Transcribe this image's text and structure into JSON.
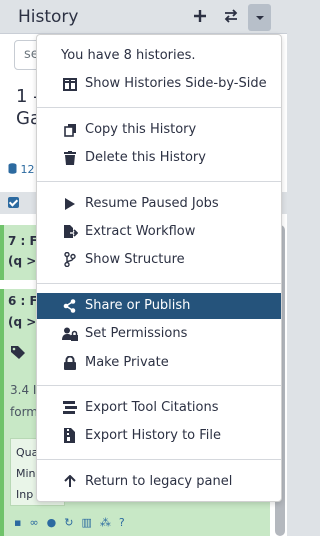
{
  "header": {
    "title": "History"
  },
  "search": {
    "partial_text": "se"
  },
  "history": {
    "name_partial": "1 -\nGa",
    "size_partial": "12"
  },
  "items": [
    {
      "title_partial": "7 : F",
      "subtitle_partial": "(q >"
    },
    {
      "title_partial": "6 : F",
      "subtitle_partial": "(q >",
      "text_line1_partial": "3.4 I",
      "text_line2_partial": "form",
      "peek_lines": [
        "Qua",
        "Min",
        "Inp"
      ]
    }
  ],
  "menu": {
    "count_text": "You have 8 histories.",
    "items": [
      {
        "label": "Show Histories Side-by-Side",
        "icon": "columns-icon"
      },
      {
        "label": "Copy this History",
        "icon": "copy-icon"
      },
      {
        "label": "Delete this History",
        "icon": "trash-icon"
      },
      {
        "label": "Resume Paused Jobs",
        "icon": "play-icon"
      },
      {
        "label": "Extract Workflow",
        "icon": "file-export-icon"
      },
      {
        "label": "Show Structure",
        "icon": "code-branch-icon"
      },
      {
        "label": "Share or Publish",
        "icon": "share-icon",
        "active": true
      },
      {
        "label": "Set Permissions",
        "icon": "user-lock-icon"
      },
      {
        "label": "Make Private",
        "icon": "lock-icon"
      },
      {
        "label": "Export Tool Citations",
        "icon": "stream-icon"
      },
      {
        "label": "Export History to File",
        "icon": "file-archive-icon"
      },
      {
        "label": "Return to legacy panel",
        "icon": "arrow-up-icon"
      }
    ]
  },
  "colors": {
    "active_bg": "#25537b",
    "item_ok_bg": "#c8e8c6",
    "accent": "#2c6aa0"
  }
}
